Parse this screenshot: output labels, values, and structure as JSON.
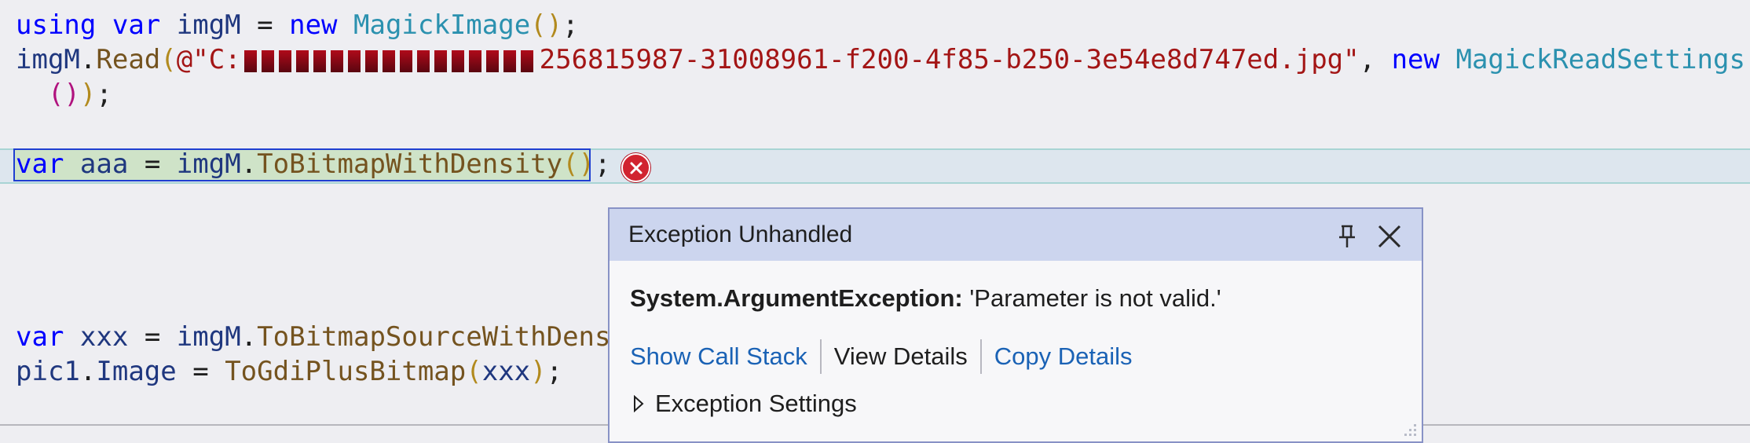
{
  "code": {
    "line1": {
      "kw_using": "using",
      "kw_var": "var",
      "name": "imgM",
      "eq": "=",
      "kw_new": "new",
      "type": "MagickImage",
      "parens": "()",
      "semi": ";"
    },
    "line2": {
      "obj": "imgM",
      "dot": ".",
      "method": "Read",
      "open_paren": "(",
      "str_start": "@\"C:",
      "str_end": "256815987-31008961-f200-4f85-b250-3e54e8d747ed.jpg\"",
      "comma": ",",
      "kw_new": "new",
      "type": "MagickReadSettings"
    },
    "line3": {
      "parens": "()",
      "close": ")",
      "semi": ";"
    },
    "line4": {
      "kw_var": "var",
      "name": "aaa",
      "eq": "=",
      "obj": "imgM",
      "dot": ".",
      "method": "ToBitmapWithDensity",
      "parens": "()",
      "semi": ";"
    },
    "line5": {
      "kw_var": "var",
      "name": "xxx",
      "eq": "=",
      "obj": "imgM",
      "dot": ".",
      "method": "ToBitmapSourceWithDensi"
    },
    "line6": {
      "obj": "pic1",
      "dot": ".",
      "prop": "Image",
      "eq": "=",
      "method": "ToGdiPlusBitmap",
      "open": "(",
      "arg": "xxx",
      "close": ")",
      "semi": ";"
    }
  },
  "exception_popup": {
    "title": "Exception Unhandled",
    "exception_type": "System.ArgumentException:",
    "message": "'Parameter is not valid.'",
    "show_call_stack": "Show Call Stack",
    "view_details": "View Details",
    "copy_details": "Copy Details",
    "exception_settings": "Exception Settings",
    "pin_icon": "pin-icon",
    "close_icon": "close-icon"
  },
  "colors": {
    "keyword": "#0000ff",
    "type": "#2b91af",
    "method": "#74531f",
    "string": "#a31515",
    "error": "#d1232f",
    "link": "#1a62b5",
    "popup_header": "#ccd5ee"
  }
}
